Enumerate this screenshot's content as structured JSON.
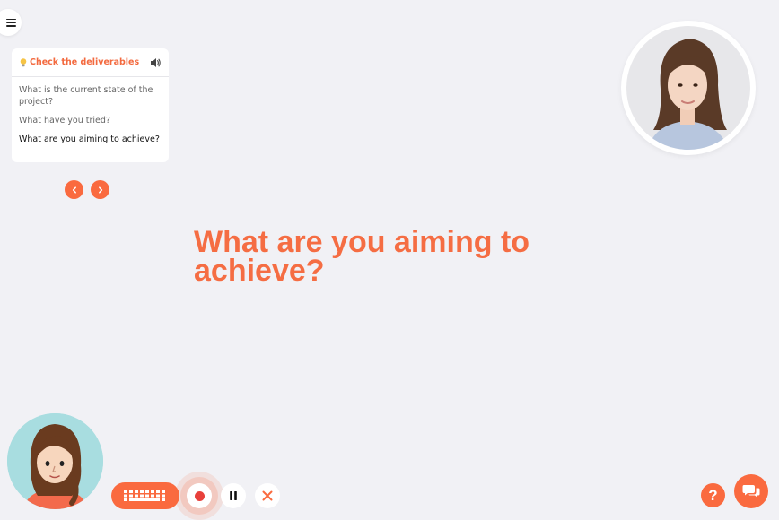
{
  "menu": {
    "icon": "hamburger-menu-icon"
  },
  "prompt_card": {
    "title": "Check the deliverables",
    "title_icon": "lightbulb-icon",
    "audio_icon": "speaker-icon",
    "questions": [
      {
        "text": "What is the current state of the project?",
        "active": false
      },
      {
        "text": "What have you tried?",
        "active": false
      },
      {
        "text": "What are you aiming to achieve?",
        "active": true
      }
    ]
  },
  "navigation": {
    "prev_icon": "chevron-left-icon",
    "next_icon": "chevron-right-icon"
  },
  "main": {
    "question": "What are you aiming to achieve?"
  },
  "controls": {
    "keyboard_icon": "keyboard-icon",
    "record_icon": "record-icon",
    "pause_icon": "pause-icon",
    "stop_icon": "close-icon"
  },
  "help": {
    "label": "?"
  },
  "chat": {
    "icon": "chat-bubbles-icon"
  },
  "colors": {
    "accent": "#fa6a3f",
    "background": "#f1f1f5",
    "record": "#e8403b"
  }
}
